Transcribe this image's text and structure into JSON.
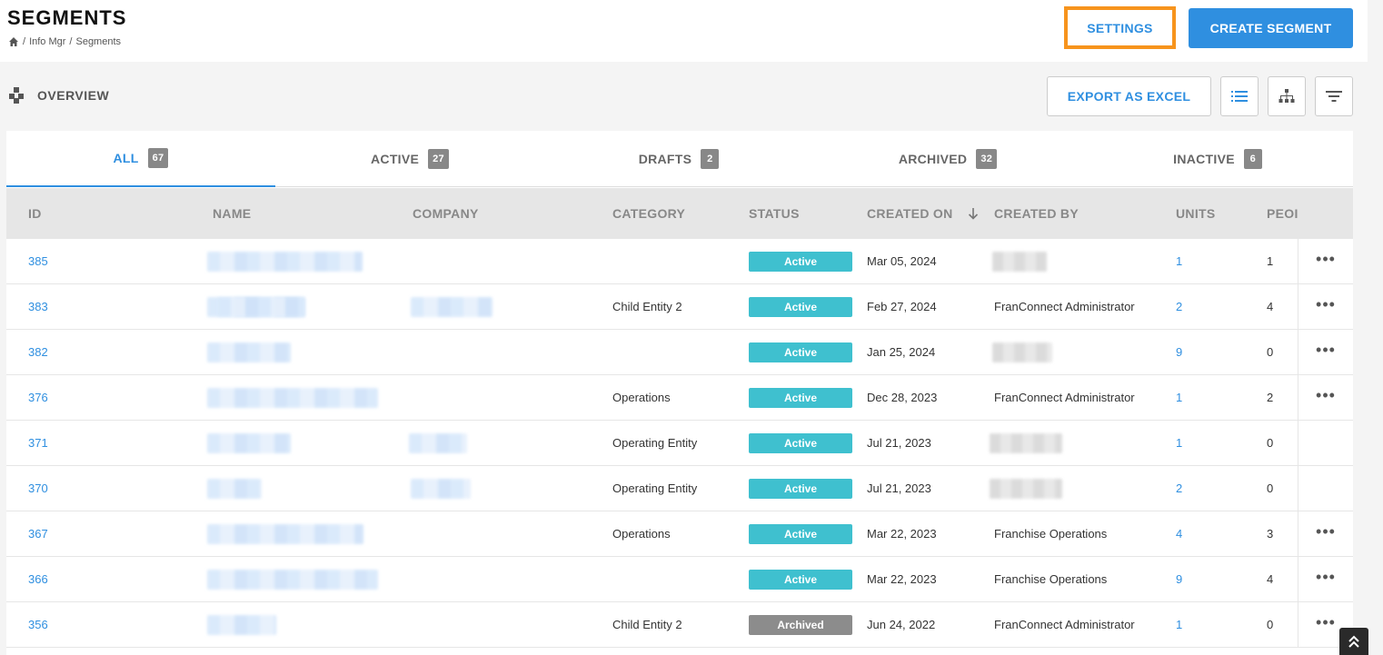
{
  "header": {
    "title": "SEGMENTS",
    "breadcrumb": [
      "Info Mgr",
      "Segments"
    ],
    "breadcrumb_sep": "/",
    "settings_label": "SETTINGS",
    "create_label": "CREATE SEGMENT"
  },
  "toolbar": {
    "overview_label": "OVERVIEW",
    "export_label": "EXPORT AS EXCEL",
    "icons": [
      "list-view-icon",
      "hierarchy-view-icon",
      "filter-icon"
    ]
  },
  "tabs": [
    {
      "label": "ALL",
      "count": "67",
      "active": true
    },
    {
      "label": "ACTIVE",
      "count": "27"
    },
    {
      "label": "DRAFTS",
      "count": "2"
    },
    {
      "label": "ARCHIVED",
      "count": "32"
    },
    {
      "label": "INACTIVE",
      "count": "6"
    }
  ],
  "columns": [
    "ID",
    "NAME",
    "COMPANY",
    "CATEGORY",
    "STATUS",
    "CREATED ON",
    "CREATED BY",
    "UNITS",
    "PEOI"
  ],
  "rows": [
    {
      "id": "385",
      "category": "",
      "status": "Active",
      "created_on": "Mar 05, 2024",
      "created_by": "",
      "units": "1",
      "people": "1",
      "more": true
    },
    {
      "id": "383",
      "category": "Child Entity 2",
      "status": "Active",
      "created_on": "Feb 27, 2024",
      "created_by": "FranConnect Administrator",
      "units": "2",
      "people": "4",
      "more": true
    },
    {
      "id": "382",
      "category": "",
      "status": "Active",
      "created_on": "Jan 25, 2024",
      "created_by": "",
      "units": "9",
      "people": "0",
      "more": true
    },
    {
      "id": "376",
      "category": "Operations",
      "status": "Active",
      "created_on": "Dec 28, 2023",
      "created_by": "FranConnect Administrator",
      "units": "1",
      "people": "2",
      "more": true
    },
    {
      "id": "371",
      "category": "Operating Entity",
      "status": "Active",
      "created_on": "Jul 21, 2023",
      "created_by": "",
      "units": "1",
      "people": "0",
      "more": false
    },
    {
      "id": "370",
      "category": "Operating Entity",
      "status": "Active",
      "created_on": "Jul 21, 2023",
      "created_by": "",
      "units": "2",
      "people": "0",
      "more": false
    },
    {
      "id": "367",
      "category": "Operations",
      "status": "Active",
      "created_on": "Mar 22, 2023",
      "created_by": "Franchise Operations",
      "units": "4",
      "people": "3",
      "more": true
    },
    {
      "id": "366",
      "category": "",
      "status": "Active",
      "created_on": "Mar 22, 2023",
      "created_by": "Franchise Operations",
      "units": "9",
      "people": "4",
      "more": true
    },
    {
      "id": "356",
      "category": "Child Entity 2",
      "status": "Archived",
      "created_on": "Jun 24, 2022",
      "created_by": "FranConnect Administrator",
      "units": "1",
      "people": "0",
      "more": true
    }
  ],
  "colors": {
    "accent": "#2f8fe0",
    "settings_outline": "#f7941d",
    "active_badge": "#3fc0cf",
    "archived_badge": "#8c8c8c"
  }
}
